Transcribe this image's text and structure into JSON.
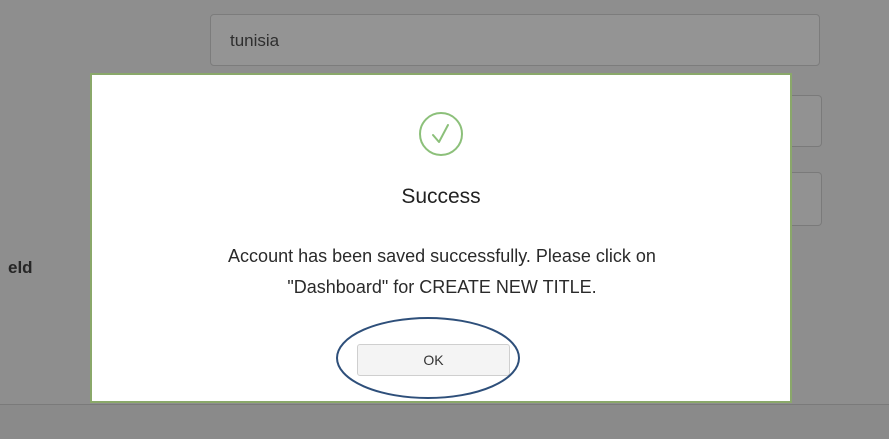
{
  "background": {
    "country_value": "tunisia",
    "field_label_fragment": "eld"
  },
  "dialog": {
    "icon": "checkmark-circle-icon",
    "title": "Success",
    "message_line1": "Account has been saved successfully. Please click on",
    "message_line2": "\"Dashboard\" for CREATE NEW TITLE.",
    "ok_label": "OK"
  },
  "colors": {
    "success_green": "#8cc07a",
    "modal_border": "#8aa86a",
    "annotation_ellipse": "#2e4f7a"
  }
}
